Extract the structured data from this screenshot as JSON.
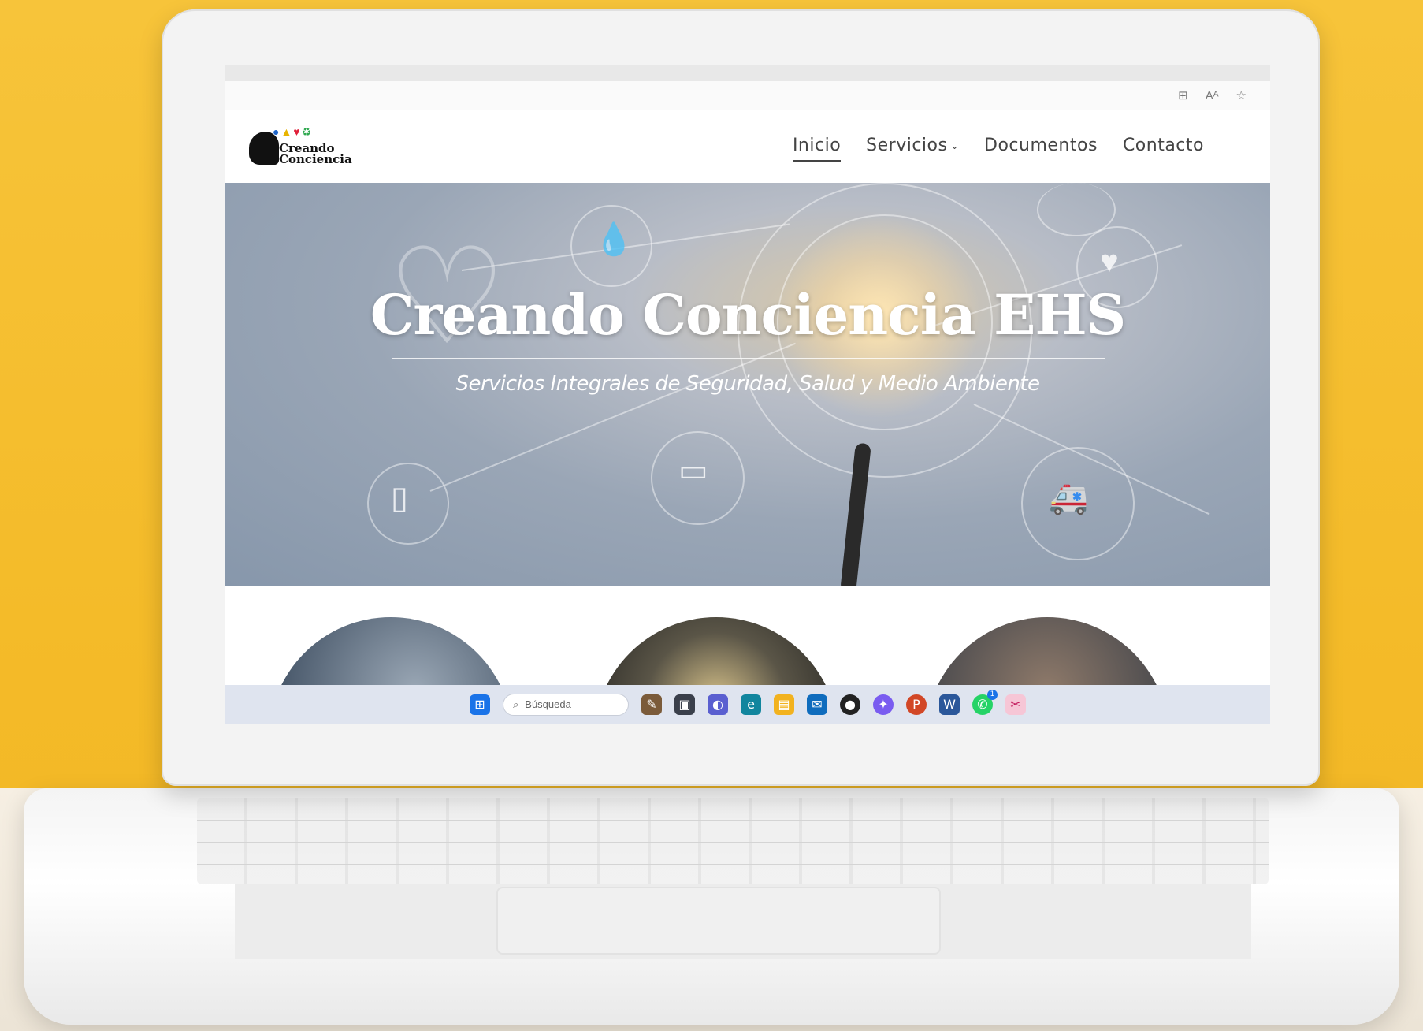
{
  "browser": {
    "favorites": [
      "",
      "",
      "",
      "",
      "",
      "",
      "",
      "",
      ""
    ],
    "toolbar_icons": [
      "apps-icon",
      "read-aloud-icon",
      "favorite-star-icon"
    ],
    "toolbar_glyphs": [
      "⊞",
      "Aᴬ",
      "☆"
    ]
  },
  "site": {
    "logo": {
      "line1": "Creando",
      "line2": "Conciencia"
    },
    "nav": [
      {
        "label": "Inicio",
        "active": true
      },
      {
        "label": "Servicios",
        "has_dropdown": true
      },
      {
        "label": "Documentos"
      },
      {
        "label": "Contacto"
      }
    ],
    "hero": {
      "title": "Creando Conciencia EHS",
      "subtitle": "Servicios Integrales de Seguridad, Salud y Medio Ambiente"
    }
  },
  "taskbar": {
    "search_placeholder": "Búsqueda",
    "pinned_icons": [
      "windows-start-icon",
      "widgets-icon",
      "task-view-icon",
      "teams-icon",
      "edge-icon",
      "file-explorer-icon",
      "mail-icon",
      "dell-icon",
      "copilot-icon",
      "powerpoint-icon",
      "word-icon",
      "whatsapp-icon",
      "snipping-tool-icon"
    ],
    "whatsapp_badge": "1"
  },
  "colors": {
    "background": "#f4bb29",
    "taskbar": "#dfe4ef",
    "hero_text": "#ffffff"
  }
}
